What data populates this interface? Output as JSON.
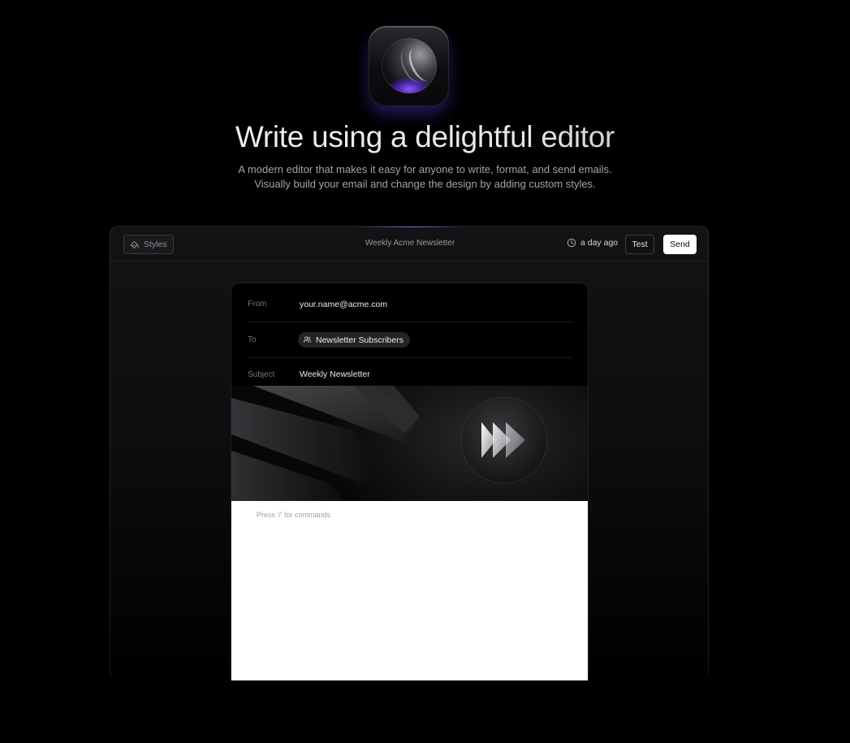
{
  "hero": {
    "headline": "Write using a delightful editor",
    "subline_1": "A modern editor that makes it easy for anyone to write, format, and send emails.",
    "subline_2": "Visually build your email and change the design by adding custom styles."
  },
  "toolbar": {
    "styles_label": "Styles",
    "document_title": "Weekly Acme Newsletter",
    "last_saved": "a day ago",
    "test_label": "Test",
    "send_label": "Send"
  },
  "email": {
    "from_label": "From",
    "from_value": "your.name@acme.com",
    "to_label": "To",
    "to_value": "Newsletter Subscribers",
    "subject_label": "Subject",
    "subject_value": "Weekly Newsletter",
    "body_placeholder": "Press '/' for commands"
  },
  "icons": {
    "app": "glass-orb-icon",
    "styles": "paint-bucket-icon",
    "time": "clock-icon",
    "recipients": "users-icon",
    "banner_logo": "fast-forward-logo"
  },
  "colors": {
    "background": "#000000",
    "accent": "#7c4dff",
    "send_button": "#ffffff"
  }
}
